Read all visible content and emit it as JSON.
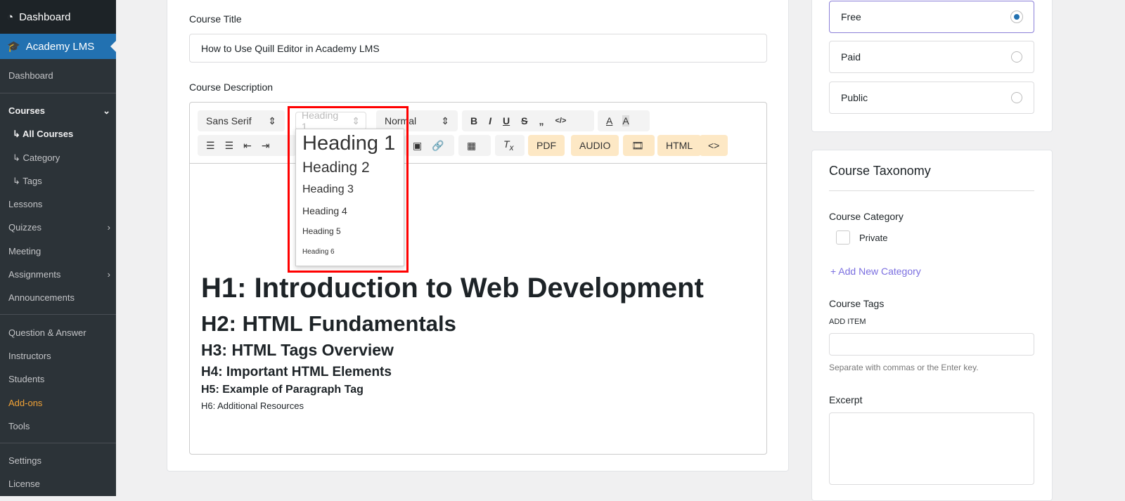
{
  "sidebar": {
    "top": "Dashboard",
    "plugin": "Academy LMS",
    "items": [
      {
        "label": "Dashboard"
      },
      {
        "label": "Courses"
      },
      {
        "label": "↳ All Courses"
      },
      {
        "label": "↳ Category"
      },
      {
        "label": "↳ Tags"
      },
      {
        "label": "Lessons"
      },
      {
        "label": "Quizzes"
      },
      {
        "label": "Meeting"
      },
      {
        "label": "Assignments"
      },
      {
        "label": "Announcements"
      },
      {
        "label": "Question & Answer"
      },
      {
        "label": "Instructors"
      },
      {
        "label": "Students"
      },
      {
        "label": "Add-ons"
      },
      {
        "label": "Tools"
      },
      {
        "label": "Settings"
      },
      {
        "label": "License"
      }
    ]
  },
  "form": {
    "title_label": "Course Title",
    "title_value": "How to Use Quill Editor in Academy LMS",
    "desc_label": "Course Description"
  },
  "toolbar": {
    "font": "Sans Serif",
    "header": "Heading 1",
    "size": "Normal",
    "pdf": "PDF",
    "audio": "AUDIO",
    "html": "HTML",
    "code": "<>"
  },
  "dropdown": [
    "Heading 1",
    "Heading 2",
    "Heading 3",
    "Heading 4",
    "Heading 5",
    "Heading 6"
  ],
  "content": [
    "H1: Introduction to Web Development",
    "H2: HTML Fundamentals",
    "H3: HTML Tags Overview",
    "H4: Important HTML Elements",
    "H5: Example of Paragraph Tag",
    "H6: Additional Resources"
  ],
  "visibility": [
    {
      "label": "Free",
      "selected": true
    },
    {
      "label": "Paid",
      "selected": false
    },
    {
      "label": "Public",
      "selected": false
    }
  ],
  "taxonomy": {
    "title": "Course Taxonomy",
    "category_label": "Course Category",
    "category_option": "Private",
    "add_category": "+ Add New Category",
    "tags_label": "Course Tags",
    "add_item": "ADD ITEM",
    "tags_hint": "Separate with commas or the Enter key.",
    "excerpt_label": "Excerpt"
  }
}
